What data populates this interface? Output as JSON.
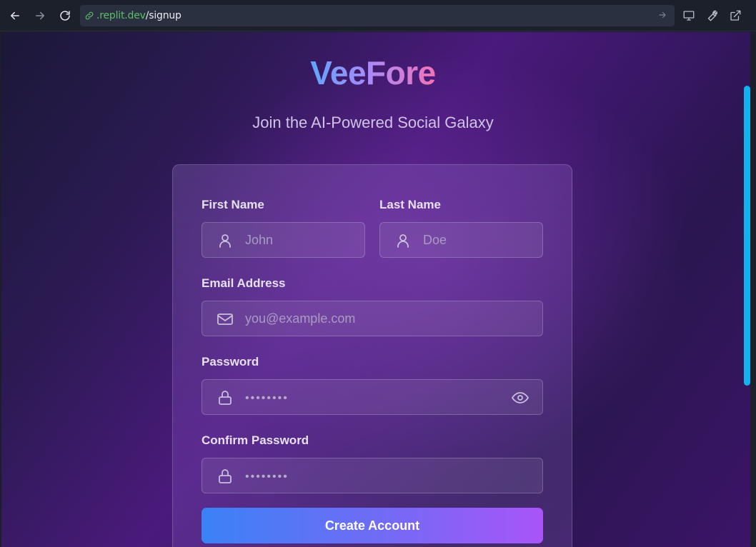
{
  "browser": {
    "url_host": ".replit.dev",
    "url_path": "/signup",
    "icons": [
      "back-arrow-icon",
      "forward-arrow-icon",
      "reload-icon",
      "link-icon",
      "go-arrow-icon",
      "monitor-icon",
      "wrench-icon",
      "external-link-icon"
    ]
  },
  "page": {
    "brand": "VeeFore",
    "tagline": "Join the AI-Powered Social Galaxy",
    "colors": {
      "brand_gradient": [
        "#60a5fa",
        "#a78bfa",
        "#f472b6"
      ],
      "button_gradient": [
        "#3b82f6",
        "#a855f7"
      ],
      "scrollbar": "#12b1f0"
    }
  },
  "form": {
    "first_name": {
      "label": "First Name",
      "placeholder": "John",
      "icon": "user-icon"
    },
    "last_name": {
      "label": "Last Name",
      "placeholder": "Doe",
      "icon": "user-icon"
    },
    "email": {
      "label": "Email Address",
      "placeholder": "you@example.com",
      "icon": "mail-icon"
    },
    "password": {
      "label": "Password",
      "placeholder": "••••••••",
      "icon": "lock-icon",
      "toggle_icon": "eye-icon"
    },
    "confirm_password": {
      "label": "Confirm Password",
      "placeholder": "••••••••",
      "icon": "lock-icon"
    },
    "submit_label": "Create Account"
  }
}
